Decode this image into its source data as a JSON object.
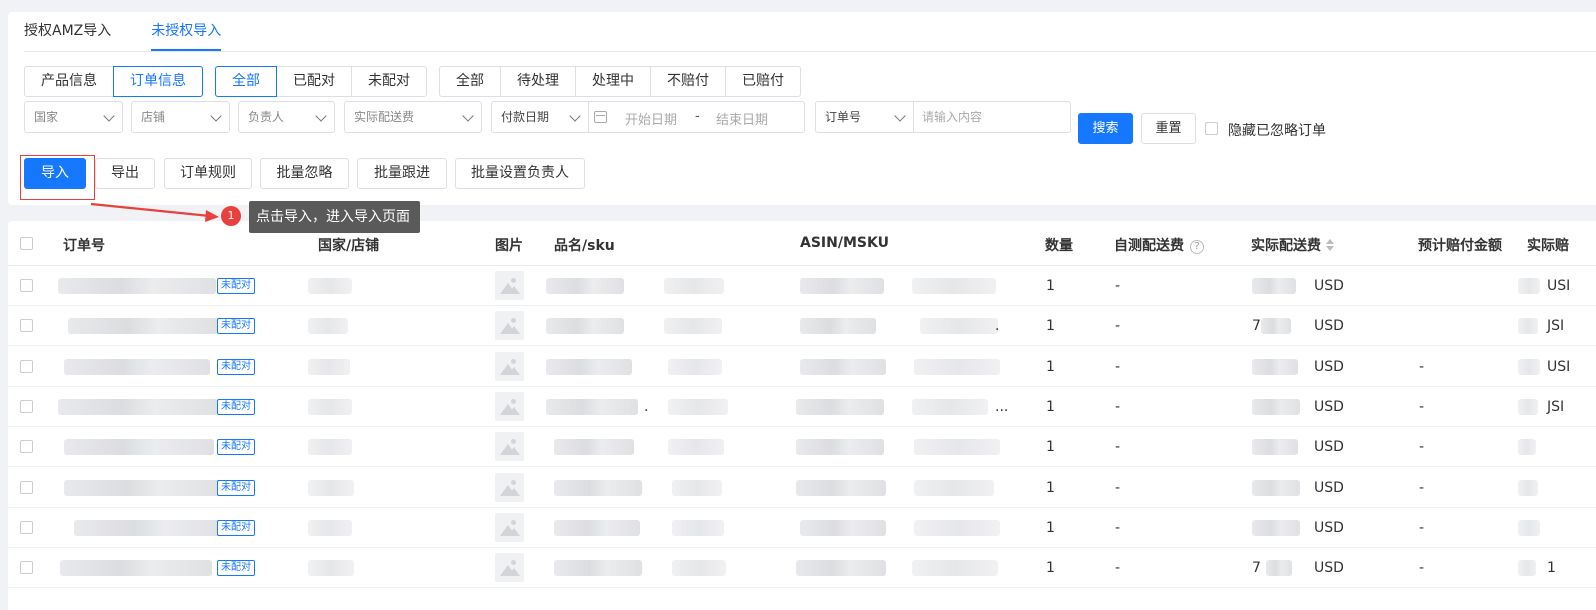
{
  "tabs": [
    {
      "label": "授权AMZ导入",
      "active": false
    },
    {
      "label": "未授权导入",
      "active": true
    }
  ],
  "type_group": [
    {
      "label": "产品信息",
      "active": false
    },
    {
      "label": "订单信息",
      "active": true
    }
  ],
  "match_group": [
    {
      "label": "全部",
      "active": true
    },
    {
      "label": "已配对",
      "active": false
    },
    {
      "label": "未配对",
      "active": false
    }
  ],
  "status_group": [
    {
      "label": "全部",
      "active": false
    },
    {
      "label": "待处理",
      "active": false
    },
    {
      "label": "处理中",
      "active": false
    },
    {
      "label": "不赔付",
      "active": false
    },
    {
      "label": "已赔付",
      "active": false
    }
  ],
  "filters": {
    "country": "国家",
    "store": "店铺",
    "owner": "负责人",
    "actual_fee": "实际配送费",
    "pay_date": "付款日期",
    "start_date": "开始日期",
    "date_sep": "-",
    "end_date": "结束日期",
    "order_no": "订单号",
    "search_placeholder": "请输入内容",
    "search_btn": "搜索",
    "reset_btn": "重置",
    "hide_ignored": "隐藏已忽略订单"
  },
  "actions": {
    "import": "导入",
    "export": "导出",
    "order_rules": "订单规则",
    "batch_ignore": "批量忽略",
    "batch_follow": "批量跟进",
    "batch_owner": "批量设置负责人"
  },
  "annotation": {
    "step": "1",
    "text": "点击导入，进入导入页面",
    "color": "#e8413d"
  },
  "table": {
    "headers": {
      "order_no": "订单号",
      "country_store": "国家/店铺",
      "image": "图片",
      "name_sku": "品名/sku",
      "asin_msku": "ASIN/MSKU",
      "qty": "数量",
      "self_fee": "自测配送费",
      "self_fee_help": "?",
      "actual_fee": "实际配送费",
      "est_comp": "预计赔付金额",
      "actual_comp": "实际赔"
    },
    "tag_label": "未配对",
    "rows": [
      {
        "qty": "1",
        "self_fee": "-",
        "fee_prefix": "",
        "currency": "USD",
        "est": "",
        "actual_tail": "USI",
        "asin_tail": "",
        "name_tail": ""
      },
      {
        "qty": "1",
        "self_fee": "-",
        "fee_prefix": "7",
        "currency": "USD",
        "est": "",
        "actual_tail": "JSI",
        "asin_tail": ".",
        "name_tail": ""
      },
      {
        "qty": "1",
        "self_fee": "-",
        "fee_prefix": "",
        "currency": "USD",
        "est": "-",
        "actual_tail": "USI",
        "asin_tail": "",
        "name_tail": ""
      },
      {
        "qty": "1",
        "self_fee": "-",
        "fee_prefix": "",
        "currency": "USD",
        "est": "-",
        "actual_tail": "JSI",
        "asin_tail": "...",
        "name_tail": "."
      },
      {
        "qty": "1",
        "self_fee": "-",
        "fee_prefix": "",
        "currency": "USD",
        "est": "-",
        "actual_tail": "",
        "asin_tail": "",
        "name_tail": ""
      },
      {
        "qty": "1",
        "self_fee": "-",
        "fee_prefix": "",
        "currency": "USD",
        "est": "-",
        "actual_tail": "",
        "asin_tail": "",
        "name_tail": ""
      },
      {
        "qty": "1",
        "self_fee": "-",
        "fee_prefix": "",
        "currency": "USD",
        "est": "-",
        "actual_tail": "",
        "asin_tail": "",
        "name_tail": ""
      },
      {
        "qty": "1",
        "self_fee": "-",
        "fee_prefix": "7",
        "currency": "USD",
        "est": "-",
        "actual_tail": "1",
        "asin_tail": "",
        "name_tail": ""
      }
    ]
  },
  "colors": {
    "primary": "#1677ff",
    "annotation_red": "#e8413d",
    "tooltip_bg": "#5a5a5a"
  }
}
